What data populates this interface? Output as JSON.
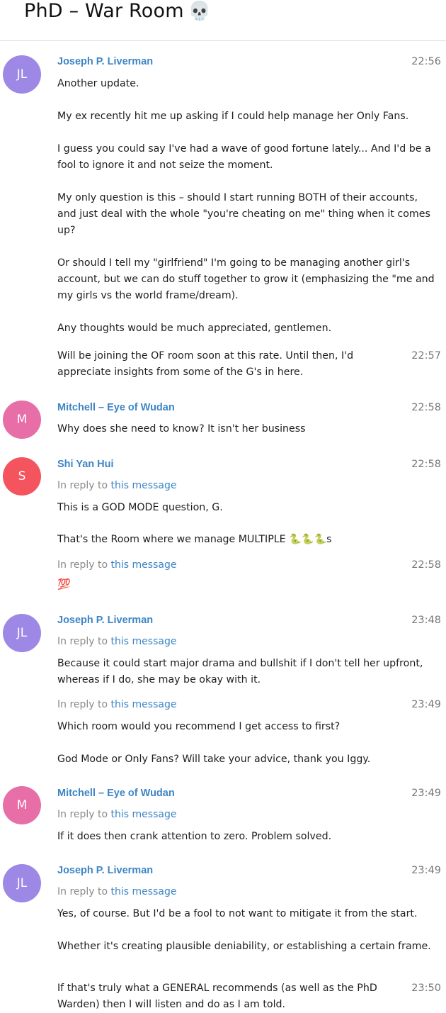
{
  "header": {
    "title": "PhD – War Room",
    "title_emoji": "💀"
  },
  "colors": {
    "avatar_jl": "#9d88e6",
    "avatar_m": "#e86ea7",
    "avatar_s": "#f4545d",
    "name": "#3d85c6"
  },
  "reply_prefix": "In reply to",
  "reply_link": "this message",
  "messages": {
    "m1": {
      "avatar": "JL",
      "author": "Joseph P. Liverman",
      "time": "22:56",
      "text": "Another update.\n\nMy ex recently hit me up asking if I could help manage her Only Fans.\n\nI guess you could say I've had a wave of good fortune lately... And I'd be a fool to ignore it and not seize the moment.\n\nMy only question is this – should I start running BOTH of their accounts, and just deal with the whole \"you're cheating on me\" thing when it comes up?\n\nOr should I tell my \"girlfriend\" I'm going to be managing another girl's account, but we can do stuff together to grow it (emphasizing the \"me and my girls vs the world frame/dream).\n\nAny thoughts would be much appreciated, gentlemen."
    },
    "m1b": {
      "time": "22:57",
      "text": "Will be joining the OF room soon at this rate. Until then, I'd appreciate insights from some of the G's in here."
    },
    "m2": {
      "avatar": "M",
      "author": "Mitchell – Eye of Wudan",
      "time": "22:58",
      "text": "Why does she need to know? It isn't her business"
    },
    "m3": {
      "avatar": "S",
      "author": "Shi Yan Hui",
      "time": "22:58",
      "text_a": "This is a GOD MODE question, G.",
      "text_b": "That's the Room where we manage MULTIPLE 🐍🐍🐍s"
    },
    "m3b": {
      "time": "22:58",
      "emoji": "💯"
    },
    "m4": {
      "avatar": "JL",
      "author": "Joseph P. Liverman",
      "time": "23:48",
      "text": "Because it could start major drama and bullshit if I don't tell her upfront, whereas if I do, she may be okay with it."
    },
    "m4b": {
      "time": "23:49",
      "text": "Which room would you recommend I get access to first?\n\nGod Mode or Only Fans? Will take your advice, thank you Iggy."
    },
    "m5": {
      "avatar": "M",
      "author": "Mitchell – Eye of Wudan",
      "time": "23:49",
      "text": "If it does then crank attention to zero. Problem solved."
    },
    "m6": {
      "avatar": "JL",
      "author": "Joseph P. Liverman",
      "time": "23:49",
      "text": "Yes, of course. But I'd be a fool to not want to mitigate it from the start.\n\nWhether it's creating plausible deniability, or establishing a certain frame."
    },
    "m6b": {
      "time": "23:50",
      "text": "If that's truly what a GENERAL recommends (as well as the PhD Warden) then I will listen and do as I am told."
    }
  }
}
